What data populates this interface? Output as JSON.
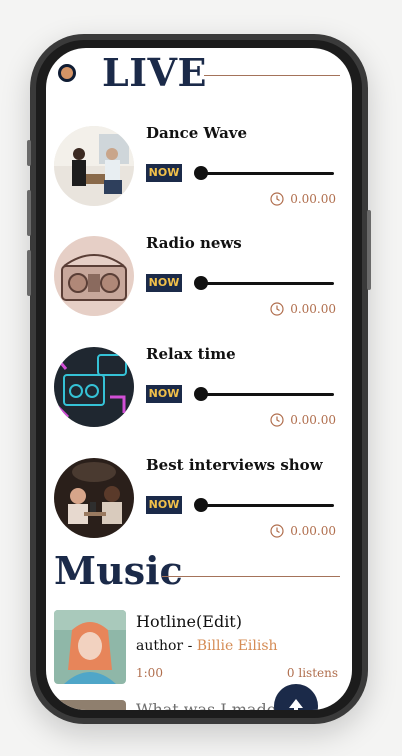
{
  "live": {
    "title": "LIVE",
    "stations": [
      {
        "name": "Dance Wave",
        "badge": "NOW",
        "time": "0.00.00"
      },
      {
        "name": "Radio news",
        "badge": "NOW",
        "time": "0.00.00"
      },
      {
        "name": "Relax time",
        "badge": "NOW",
        "time": "0.00.00"
      },
      {
        "name": "Best interviews show",
        "badge": "NOW",
        "time": "0.00.00"
      }
    ]
  },
  "music": {
    "title": "Music",
    "songs": [
      {
        "title": "Hotline(Edit)",
        "author_prefix": "author -",
        "artist": "Billie Eilish",
        "duration": "1:00",
        "listens": "0 listens"
      }
    ],
    "next_title_partial": "What was I made"
  },
  "colors": {
    "navy": "#1b2a49",
    "accent": "#d58c55",
    "badge_text": "#f1c04a"
  },
  "icons": {
    "clock": "clock-icon",
    "scroll_top": "arrow-up-icon",
    "live_indicator": "live-dot-icon"
  }
}
